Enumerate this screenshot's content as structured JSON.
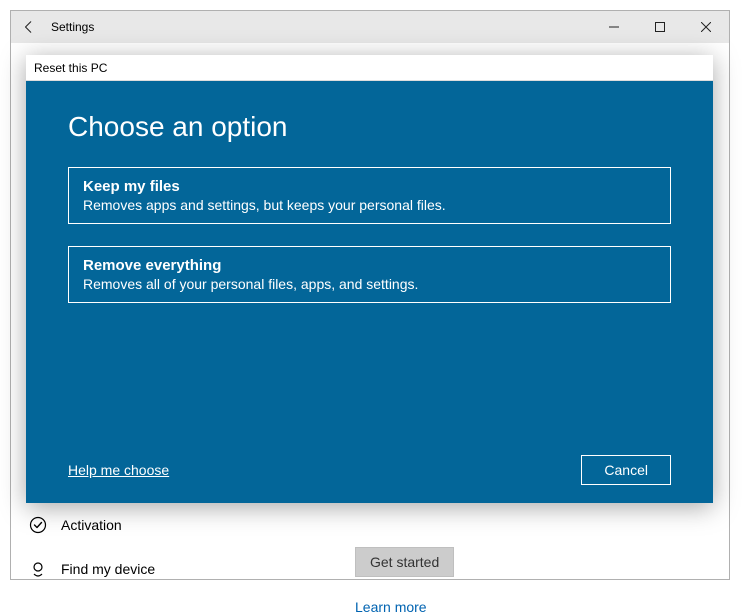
{
  "window": {
    "title": "Settings"
  },
  "sidebar": {
    "items": {
      "activation": "Activation",
      "find_my_device": "Find my device"
    }
  },
  "main": {
    "get_started_button": "Get started",
    "learn_more_link": "Learn more"
  },
  "dialog": {
    "title": "Reset this PC",
    "heading": "Choose an option",
    "options": [
      {
        "title": "Keep my files",
        "desc": "Removes apps and settings, but keeps your personal files."
      },
      {
        "title": "Remove everything",
        "desc": "Removes all of your personal files, apps, and settings."
      }
    ],
    "help_link": "Help me choose",
    "cancel_button": "Cancel"
  }
}
